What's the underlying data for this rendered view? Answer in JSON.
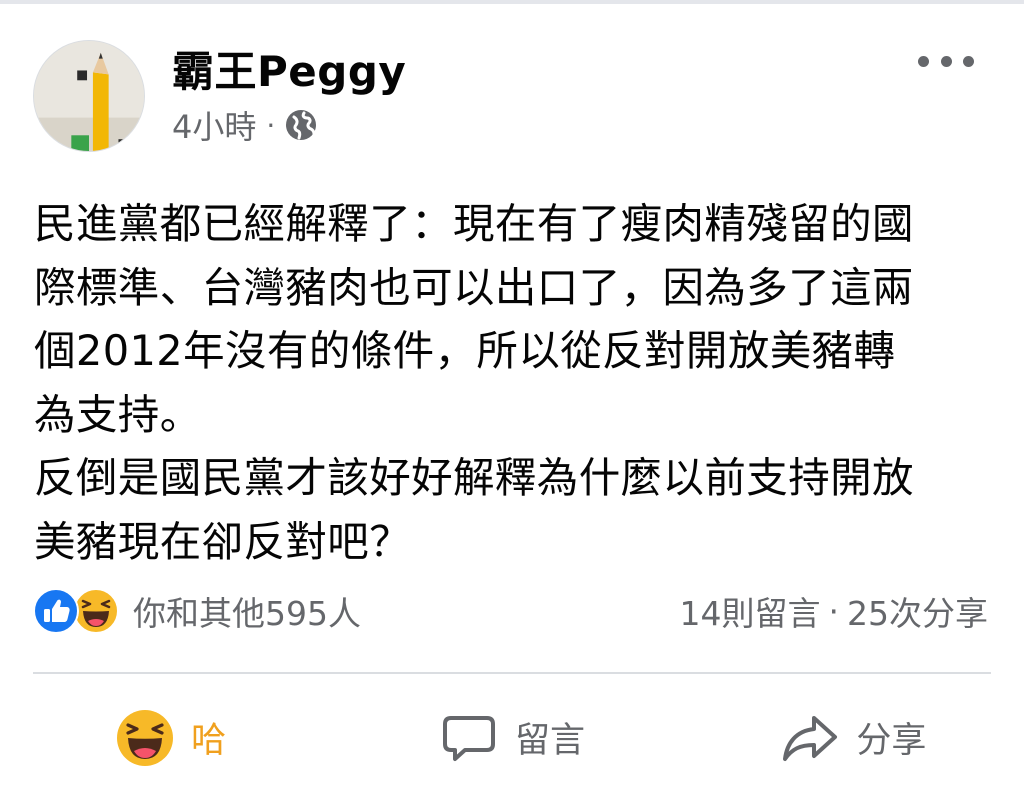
{
  "post": {
    "author": "霸王Peggy",
    "time": "4小時",
    "separator": "·",
    "privacy_icon": "globe-icon",
    "more_icon": "ellipsis-icon",
    "text_lines": [
      "民進黨都已經解釋了：現在有了瘦肉精殘留的國",
      "際標準、台灣豬肉也可以出口了，因為多了這兩",
      "個2012年沒有的條件，所以從反對開放美豬轉",
      "為支持。",
      "反倒是國民黨才該好好解釋為什麼以前支持開放",
      "美豬現在卻反對吧？"
    ]
  },
  "reactions": {
    "icons": [
      "like-icon",
      "haha-icon"
    ],
    "summary": "你和其他595人"
  },
  "stats": {
    "comments": "14則留言",
    "separator": "·",
    "shares": "25次分享"
  },
  "actions": {
    "react_label": "哈",
    "comment_label": "留言",
    "share_label": "分享"
  },
  "colors": {
    "like_blue": "#1877f2",
    "haha_yellow": "#f7b928",
    "secondary_text": "#65676b",
    "active_reaction": "#f0a01e"
  }
}
